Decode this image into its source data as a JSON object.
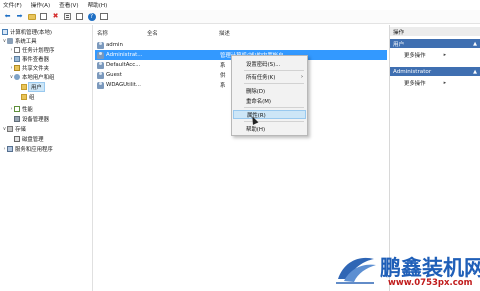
{
  "menubar": [
    "文件(F)",
    "操作(A)",
    "查看(V)",
    "帮助(H)"
  ],
  "tree": {
    "root": "计算机管理(本地)",
    "system_tools": "系统工具",
    "task_scheduler": "任务计划程序",
    "event_viewer": "事件查看器",
    "shared_folders": "共享文件夹",
    "local_users_groups": "本地用户和组",
    "users": "用户",
    "groups": "组",
    "performance": "性能",
    "device_manager": "设备管理器",
    "storage": "存储",
    "disk_management": "磁盘管理",
    "services_apps": "服务和应用程序"
  },
  "list": {
    "col_name": "名称",
    "col_fullname": "全名",
    "col_desc": "描述",
    "rows": [
      {
        "name": "admin",
        "fullname": "",
        "desc": ""
      },
      {
        "name": "Administrat...",
        "fullname": "",
        "desc": "管理计算机(域)的内置帐户"
      },
      {
        "name": "DefaultAcc...",
        "fullname": "",
        "desc": "系"
      },
      {
        "name": "Guest",
        "fullname": "",
        "desc": "供"
      },
      {
        "name": "WDAGUtilit...",
        "fullname": "",
        "desc": "系"
      }
    ]
  },
  "context_menu": {
    "set_password": "设置密码(S)...",
    "all_tasks": "所有任务(K)",
    "delete": "删除(D)",
    "rename": "重命名(M)",
    "properties": "属性(R)",
    "help": "帮助(H)"
  },
  "actions": {
    "header": "操作",
    "section1": "用户",
    "more1": "更多操作",
    "section2": "Administrator",
    "more2": "更多操作"
  },
  "watermark": {
    "name": "鹏鑫装机网",
    "url": "www.0753px.com"
  },
  "colors": {
    "selection": "#3399ff",
    "action_section": "#3f6fb1",
    "watermark_name": "#1f5fb8",
    "watermark_url": "#c01b1b"
  }
}
